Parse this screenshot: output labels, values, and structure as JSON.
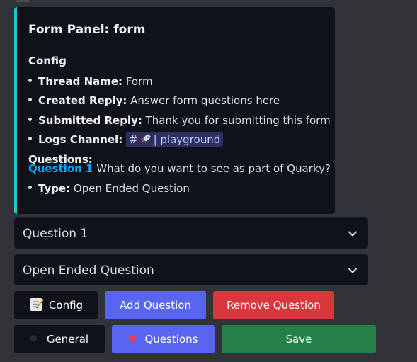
{
  "embed": {
    "title": "Form Panel: form",
    "accent_color": "#1fc8d6",
    "config_heading": "Config",
    "config_items": [
      {
        "label": "Thread Name:",
        "value": "Form"
      },
      {
        "label": "Created Reply:",
        "value": "Answer form questions here"
      },
      {
        "label": "Submitted Reply:",
        "value": "Thank you for submitting this form"
      },
      {
        "label": "Logs Channel:",
        "value": ""
      }
    ],
    "logs_channel": {
      "hash": "#",
      "icon": "rocket-emoji",
      "name": "| playground"
    },
    "questions_heading": "Questions:",
    "question_link": "Question 1",
    "question_text": "What do you want to see as part of Quarky?",
    "question_type_label": "Type:",
    "question_type_value": "Open Ended Question"
  },
  "selects": {
    "question_select": "Question 1",
    "type_select": "Open Ended Question"
  },
  "buttons": {
    "config": {
      "label": "Config",
      "icon": "memo-emoji"
    },
    "add_question": "Add Question",
    "remove_question": "Remove Question",
    "general": {
      "label": "General",
      "dot_color": "#1e1f22"
    },
    "questions": {
      "label": "Questions",
      "dot_color": "#f23f43"
    },
    "save": "Save"
  },
  "colors": {
    "primary": "#5865f2",
    "danger": "#da373c",
    "success": "#248046",
    "link": "#00a8fc"
  }
}
